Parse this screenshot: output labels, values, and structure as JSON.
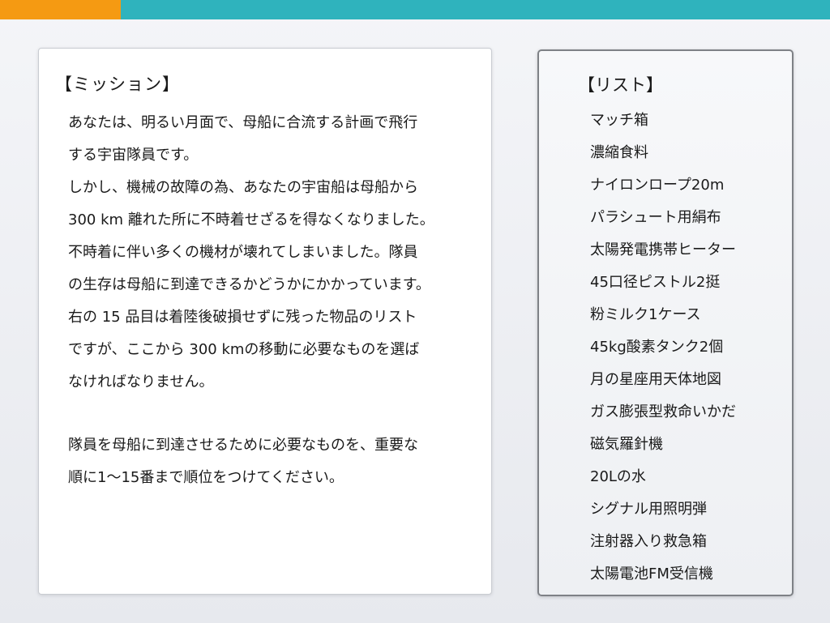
{
  "colors": {
    "top_bar": "#2fb3bd",
    "top_bar_accent": "#f59a12",
    "text": "#1a1a1a"
  },
  "mission": {
    "title": "【ミッション】",
    "lines": [
      "あなたは、明るい月面で、母船に合流する計画で飛行",
      "する宇宙隊員です。",
      "しかし、機械の故障の為、あなたの宇宙船は母船から",
      "300 km 離れた所に不時着せざるを得なくなりました。",
      "不時着に伴い多くの機材が壊れてしまいました。隊員",
      "の生存は母船に到達できるかどうかにかかっています。",
      "右の 15 品目は着陸後破損せずに残った物品のリスト",
      "ですが、ここから 300 kmの移動に必要なものを選ば",
      "なければなりません。"
    ],
    "instruction_lines": [
      "隊員を母船に到達させるために必要なものを、重要な",
      "順に1〜15番まで順位をつけてください。"
    ]
  },
  "list": {
    "title": "【リスト】",
    "items": [
      "マッチ箱",
      "濃縮食料",
      "ナイロンロープ20m",
      "パラシュート用絹布",
      "太陽発電携帯ヒーター",
      "45口径ピストル2挺",
      "粉ミルク1ケース",
      "45kg酸素タンク2個",
      "月の星座用天体地図",
      "ガス膨張型救命いかだ",
      "磁気羅針機",
      "20Lの水",
      "シグナル用照明弾",
      "注射器入り救急箱",
      "太陽電池FM受信機"
    ]
  }
}
